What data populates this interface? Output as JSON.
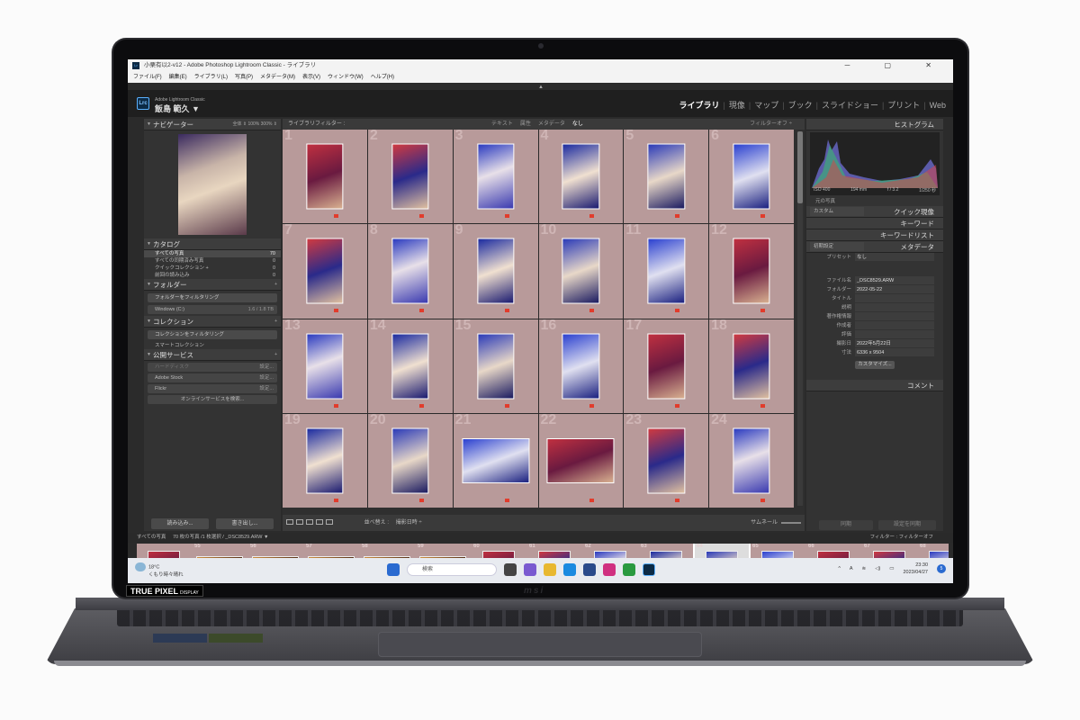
{
  "window": {
    "title": "小栗有以2-v12 - Adobe Photoshop Lightroom Classic - ライブラリ",
    "controls": "─ ▢ ✕"
  },
  "menu": [
    "ファイル(F)",
    "編集(E)",
    "ライブラリ(L)",
    "写真(P)",
    "メタデータ(M)",
    "表示(V)",
    "ウィンドウ(W)",
    "ヘルプ(H)"
  ],
  "identity": {
    "logo": "Lrc",
    "product": "Adobe Lightroom Classic",
    "user": "飯島 範久 ▼"
  },
  "modules": [
    "ライブラリ",
    "現像",
    "マップ",
    "ブック",
    "スライドショー",
    "プリント",
    "Web"
  ],
  "left": {
    "navigator": {
      "title": "ナビゲーター",
      "zoom": "全体  ⇕  100%  300%  ⇕"
    },
    "catalog": {
      "title": "カタログ",
      "items": [
        {
          "label": "すべての写真",
          "count": "70"
        },
        {
          "label": "すべての同期済み写真",
          "count": "0"
        },
        {
          "label": "クイックコレクション +",
          "count": "0"
        },
        {
          "label": "前回の読み込み",
          "count": "0"
        }
      ]
    },
    "folders": {
      "title": "フォルダー",
      "filter": "フォルダーをフィルタリング",
      "drive": "Windows (C:)",
      "drive_size": "1.6 / 1.8 TB"
    },
    "collections": {
      "title": "コレクション",
      "filter": "コレクションをフィルタリング",
      "smart": "スマートコレクション"
    },
    "publish": {
      "title": "公開サービス",
      "items": [
        {
          "label": "ハードディスク",
          "action": "設定..."
        },
        {
          "label": "Adobe Stock",
          "action": "設定..."
        },
        {
          "label": "Flickr",
          "action": "設定..."
        }
      ],
      "find_more": "オンラインサービスを検索..."
    },
    "import": "読み込み...",
    "export": "書き出し..."
  },
  "center": {
    "filter_title": "ライブラリフィルター :",
    "filter_options": [
      "テキスト",
      "属性",
      "メタデータ",
      "なし"
    ],
    "filter_active": "なし",
    "filter_off": "フィルターオフ ÷",
    "grid_numbers": [
      "1",
      "2",
      "3",
      "4",
      "5",
      "6",
      "7",
      "8",
      "9",
      "10",
      "11",
      "12",
      "13",
      "14",
      "15",
      "16",
      "17",
      "18",
      "19",
      "20",
      "21",
      "22",
      "23",
      "24"
    ],
    "sort_label": "並べ替え :",
    "sort_value": "撮影日時 ÷",
    "thumb_label": "サムネール"
  },
  "right": {
    "histogram": {
      "title": "ヒストグラム",
      "iso": "ISO 400",
      "focal": "194 mm",
      "aperture": "f / 3.2",
      "shutter": "1/250 秒",
      "original": "元の写真"
    },
    "quick_develop": {
      "title": "クイック現像",
      "preset": "カスタム"
    },
    "keywording": "キーワード",
    "keyword_list": "キーワードリスト",
    "metadata": {
      "title": "メタデータ",
      "preset_label": "初期設定",
      "preset_row_label": "プリセット",
      "preset_row_value": "なし",
      "fields": [
        {
          "k": "ファイル名",
          "v": "_DSC8529.ARW"
        },
        {
          "k": "フォルダー",
          "v": "2022-05-22"
        },
        {
          "k": "タイトル",
          "v": ""
        },
        {
          "k": "説明",
          "v": ""
        },
        {
          "k": "著作権情報",
          "v": ""
        },
        {
          "k": "作成者",
          "v": ""
        },
        {
          "k": "評価",
          "v": ""
        },
        {
          "k": "撮影日",
          "v": "2022年5月22日"
        },
        {
          "k": "寸法",
          "v": "6336 x 9504"
        }
      ],
      "customize": "カスタマイズ..."
    },
    "comments": "コメント",
    "sync": "同期",
    "sync_settings": "設定を同期"
  },
  "filmstrip": {
    "source": "すべての写真",
    "info": "70 枚の写真 /1 枚選択 / _DSC8529.ARW ▼",
    "filter": "フィルター :  フィルターオフ",
    "numbers": [
      "",
      "55",
      "56",
      "57",
      "58",
      "59",
      "60",
      "61",
      "62",
      "63",
      "64",
      "65",
      "66",
      "67",
      "68"
    ],
    "selected_index": 10
  },
  "taskbar": {
    "temp": "18°C",
    "weather": "くもり時々晴れ",
    "search": "検索",
    "time": "23:30",
    "date": "2023/04/27",
    "lang": "A",
    "notifications": "5"
  },
  "laptop": {
    "badge": "TRUE PIXEL",
    "badge_sub": "DISPLAY",
    "brand": "msi"
  },
  "colors": {
    "selected_flag": "#e13c2c",
    "grid_bg": "#b89a9a",
    "lr_blue": "#5ab0ff"
  }
}
